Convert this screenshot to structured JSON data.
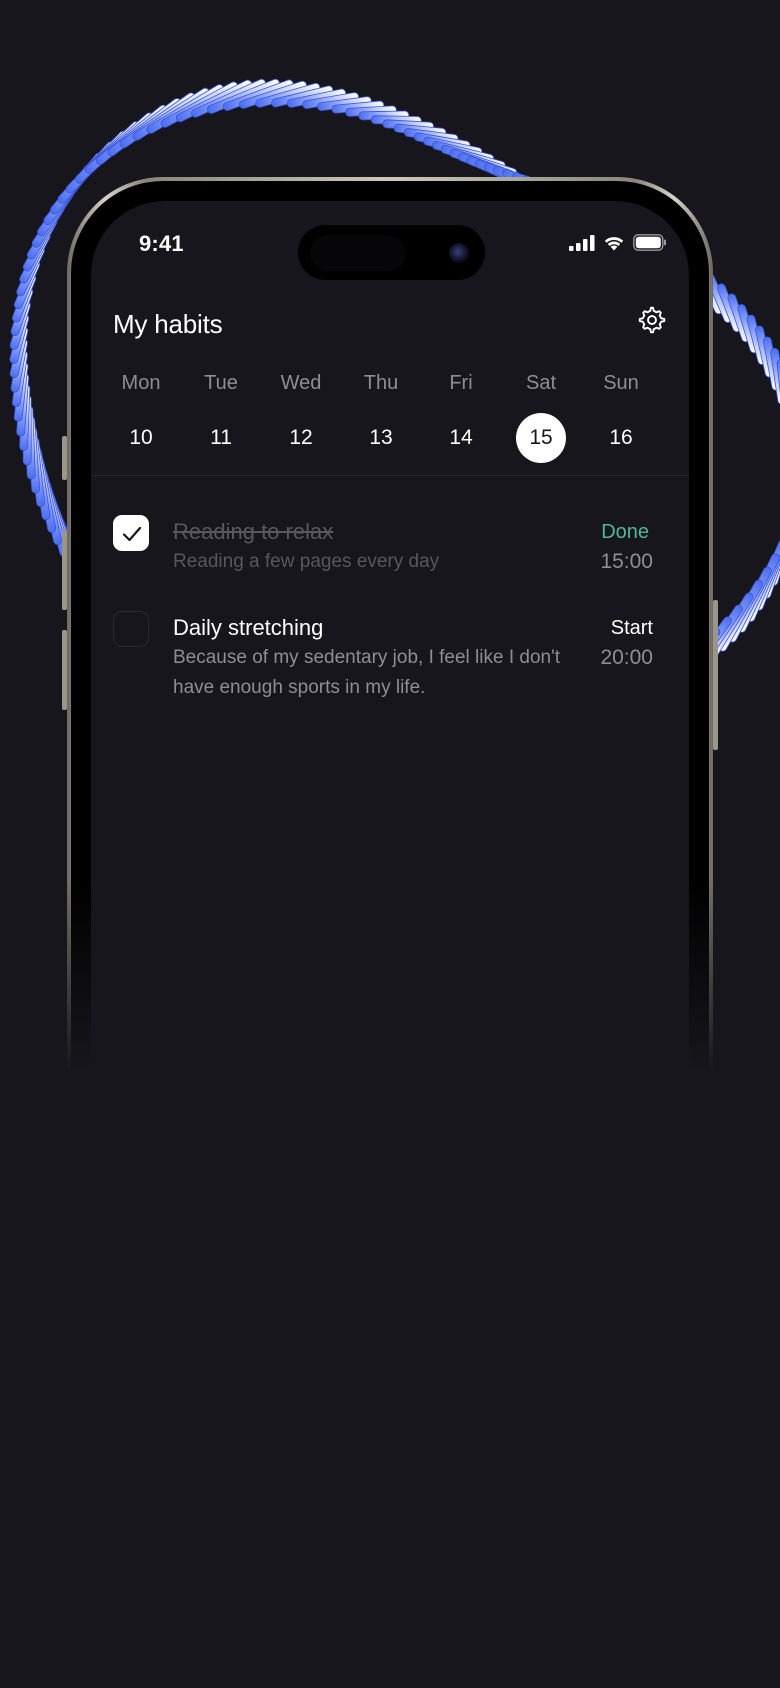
{
  "status_bar": {
    "time": "9:41"
  },
  "header": {
    "title": "My habits"
  },
  "week": [
    {
      "name": "Mon",
      "date": "10",
      "selected": false
    },
    {
      "name": "Tue",
      "date": "11",
      "selected": false
    },
    {
      "name": "Wed",
      "date": "12",
      "selected": false
    },
    {
      "name": "Thu",
      "date": "13",
      "selected": false
    },
    {
      "name": "Fri",
      "date": "14",
      "selected": false
    },
    {
      "name": "Sat",
      "date": "15",
      "selected": true
    },
    {
      "name": "Sun",
      "date": "16",
      "selected": false
    }
  ],
  "habits": [
    {
      "title": "Reading to relax",
      "description": "Reading a few pages every day",
      "status": "Done",
      "time": "15:00",
      "checked": true
    },
    {
      "title": "Daily stretching",
      "description": "Because of my sedentary job, I feel like I don't have enough sports in my life.",
      "status": "Start",
      "time": "20:00",
      "checked": false
    }
  ],
  "colors": {
    "background": "#17161c",
    "accent_done": "#4fb59a",
    "muted": "#8e8d95",
    "art": "#4a6cf0"
  },
  "icons": [
    "signal-icon",
    "wifi-icon",
    "battery-icon",
    "gear-icon",
    "checkmark-icon"
  ]
}
